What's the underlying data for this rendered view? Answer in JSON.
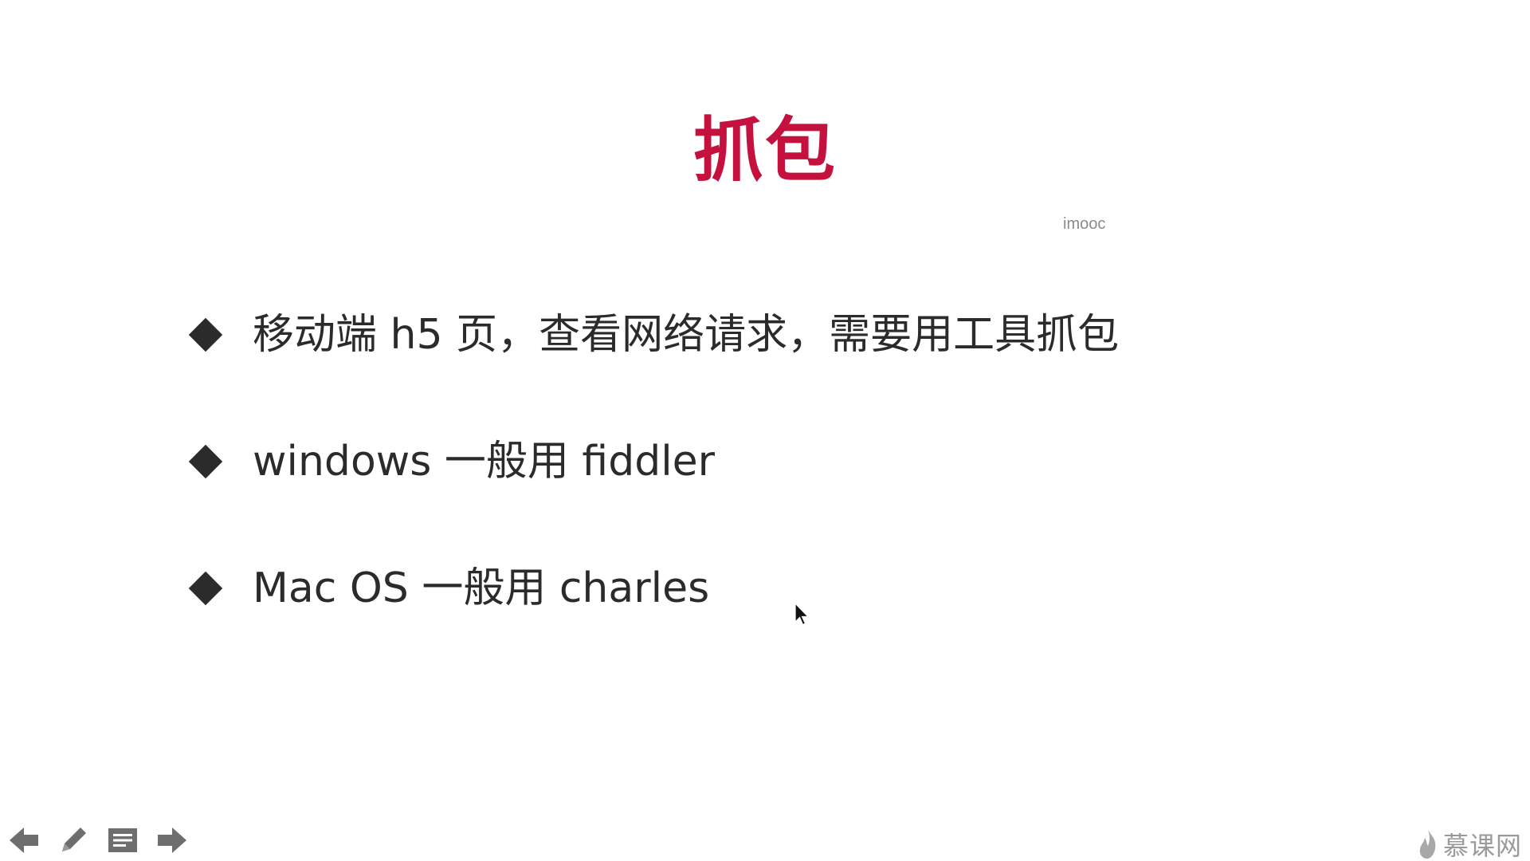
{
  "slide": {
    "title": "抓包",
    "watermark": "imooc",
    "bullets": [
      {
        "text": "移动端 h5 页，查看网络请求，需要用工具抓包"
      },
      {
        "text": "windows 一般用 fiddler"
      },
      {
        "text": "Mac OS 一般用 charles"
      }
    ],
    "title_color": "#c4113d",
    "text_color": "#2b2b2b"
  },
  "toolbar": {
    "items": [
      {
        "icon": "arrow-left-icon"
      },
      {
        "icon": "pencil-icon"
      },
      {
        "icon": "notes-icon"
      },
      {
        "icon": "arrow-right-icon"
      }
    ]
  },
  "brand": {
    "icon": "flame-logo-icon",
    "text": "慕课网"
  }
}
